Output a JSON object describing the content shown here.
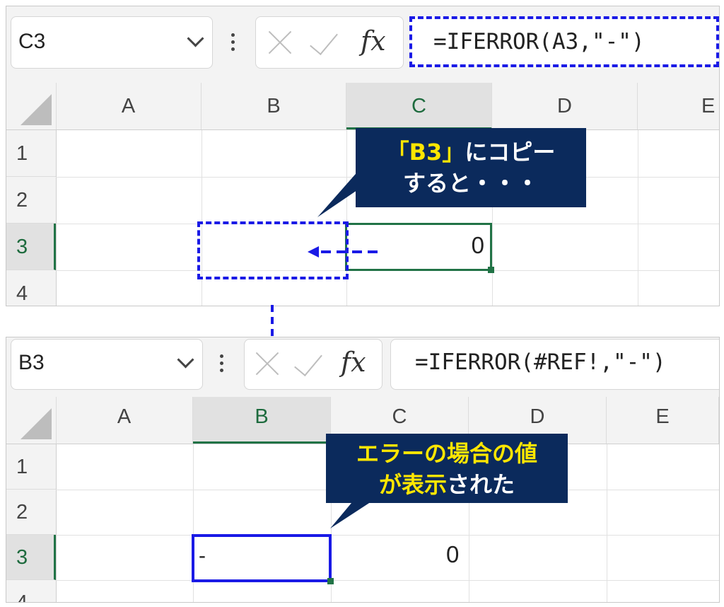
{
  "top": {
    "name_box": "C3",
    "formula": "=IFERROR(A3,\"-\")",
    "columns": [
      "A",
      "B",
      "C",
      "D",
      "E"
    ],
    "rows": [
      "1",
      "2",
      "3",
      "4"
    ],
    "cell_c3": "0",
    "callout_hl": "「B3」",
    "callout_rest": "にコピー",
    "callout_line2": "すると・・・"
  },
  "bottom": {
    "name_box": "B3",
    "formula": "=IFERROR(#REF!,\"-\")",
    "columns": [
      "A",
      "B",
      "C",
      "D",
      "E"
    ],
    "rows": [
      "1",
      "2",
      "3",
      "4"
    ],
    "cell_b3": "-",
    "cell_c3": "0",
    "callout_line1": "エラーの場合の値",
    "callout_hl": "が表示",
    "callout_rest": "された"
  },
  "icons": {
    "cancel": "cross-icon",
    "enter": "check-icon",
    "function": "fx-icon"
  },
  "colors": {
    "excel_green": "#217346",
    "blue_dash": "#1a1ae6",
    "callout_bg": "#0b2a5c",
    "highlight_yellow": "#ffe600"
  }
}
